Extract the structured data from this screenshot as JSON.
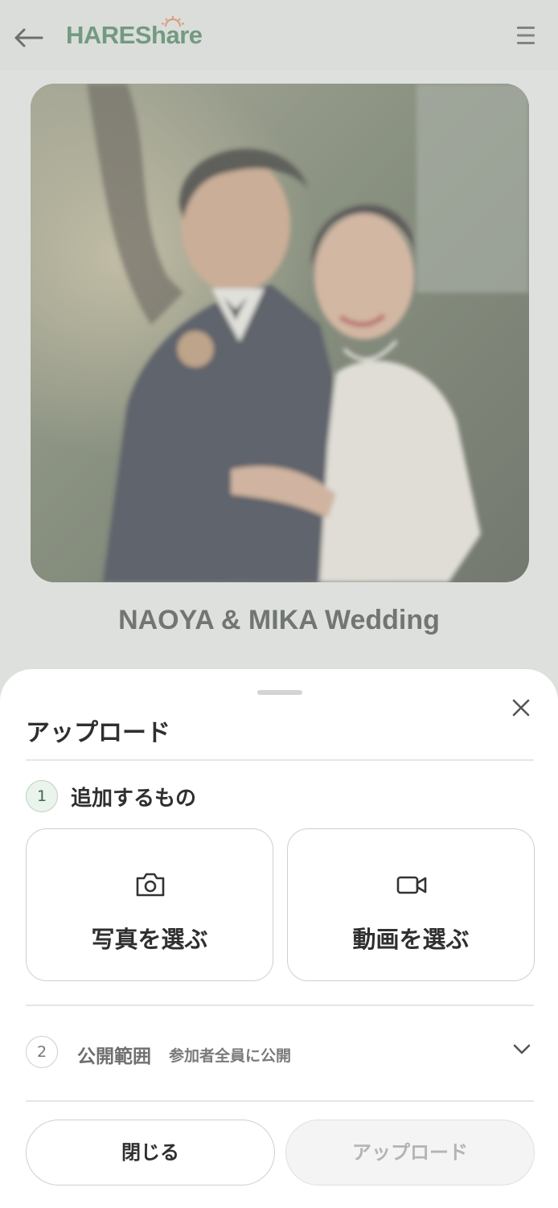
{
  "app": {
    "logo_text": "HAREShare",
    "brand_color": "#3b7a52"
  },
  "header": {
    "back_icon": "arrow-left-icon",
    "menu_icon": "hamburger-menu-icon"
  },
  "event": {
    "title": "NAOYA & MIKA Wedding"
  },
  "sheet": {
    "title": "アップロード",
    "close_icon": "close-icon",
    "step1": {
      "number": "1",
      "label": "追加するもの",
      "options": [
        {
          "icon": "camera-icon",
          "label": "写真を選ぶ"
        },
        {
          "icon": "video-camera-icon",
          "label": "動画を選ぶ"
        }
      ]
    },
    "step2": {
      "number": "2",
      "label": "公開範囲",
      "value": "参加者全員に公開",
      "chevron_icon": "chevron-down-icon"
    },
    "buttons": {
      "close_label": "閉じる",
      "upload_label": "アップロード",
      "upload_enabled": false
    }
  }
}
